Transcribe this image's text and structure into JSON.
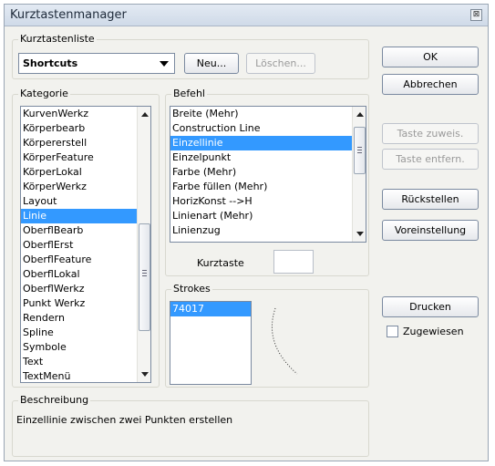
{
  "window": {
    "title": "Kurztastenmanager",
    "close_glyph": "⊠"
  },
  "shortcut_list": {
    "label": "Kurztastenliste",
    "selected": "Shortcuts",
    "new_button": "Neu...",
    "delete_button": "Löschen..."
  },
  "category": {
    "label": "Kategorie",
    "items": [
      "KurvenWerkz",
      "Körperbearb",
      "Körpererstell",
      "KörperFeature",
      "KörperLokal",
      "KörperWerkz",
      "Layout",
      "Linie",
      "OberflBearb",
      "OberflErst",
      "OberflFeature",
      "OberflLokal",
      "OberflWerkz",
      "Punkt Werkz",
      "Rendern",
      "Spline",
      "Symbole",
      "Text",
      "TextMenü"
    ],
    "selected": "Linie"
  },
  "command": {
    "label": "Befehl",
    "items": [
      "Breite (Mehr)",
      "Construction Line",
      "Einzellinie",
      "Einzelpunkt",
      "Farbe (Mehr)",
      "Farbe füllen (Mehr)",
      "HorizKonst -->H",
      "Linienart (Mehr)",
      "Linienzug"
    ],
    "selected": "Einzellinie"
  },
  "shortcut_key": {
    "label": "Kurztaste",
    "value": ""
  },
  "strokes": {
    "label": "Strokes",
    "items": [
      "74017"
    ],
    "selected": "74017"
  },
  "description": {
    "label": "Beschreibung",
    "text": "Einzellinie zwischen zwei Punkten erstellen"
  },
  "buttons": {
    "ok": "OK",
    "cancel": "Abbrechen",
    "assign_key": "Taste zuweis.",
    "remove_key": "Taste entfern.",
    "reset": "Rückstellen",
    "preset": "Voreinstellung",
    "print": "Drucken"
  },
  "assigned": {
    "label": "Zugewiesen",
    "checked": false
  }
}
